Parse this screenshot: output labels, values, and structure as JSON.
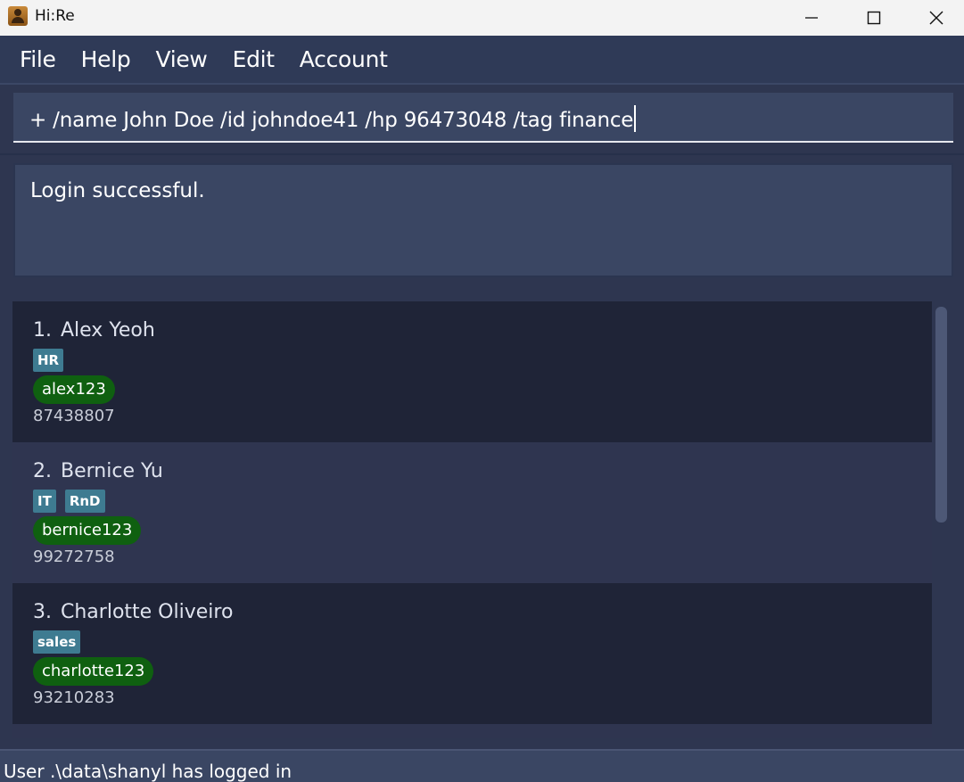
{
  "window": {
    "title": "Hi:Re",
    "app_icon": "contact-book-icon",
    "controls": [
      "minimize-icon",
      "maximize-icon",
      "close-icon"
    ]
  },
  "menu": {
    "items": [
      {
        "label": "File"
      },
      {
        "label": "Help"
      },
      {
        "label": "View"
      },
      {
        "label": "Edit"
      },
      {
        "label": "Account"
      }
    ]
  },
  "command": {
    "value": "+ /name John Doe /id johndoe41 /hp 96473048 /tag finance"
  },
  "result": {
    "text": "Login successful."
  },
  "persons": [
    {
      "index": "1.",
      "name": "Alex Yeoh",
      "tags": [
        "HR"
      ],
      "username": "alex123",
      "phone": "87438807"
    },
    {
      "index": "2.",
      "name": "Bernice Yu",
      "tags": [
        "IT",
        "RnD"
      ],
      "username": "bernice123",
      "phone": "99272758"
    },
    {
      "index": "3.",
      "name": "Charlotte Oliveiro",
      "tags": [
        "sales"
      ],
      "username": "charlotte123",
      "phone": "93210283"
    }
  ],
  "status": {
    "text": "User .\\data\\shanyl has logged in"
  },
  "colors": {
    "background": "#2e3650",
    "card_dark": "#1f2437",
    "card_light": "#2f3550",
    "tag": "#3e7b91",
    "username_pill": "#0f6010"
  }
}
